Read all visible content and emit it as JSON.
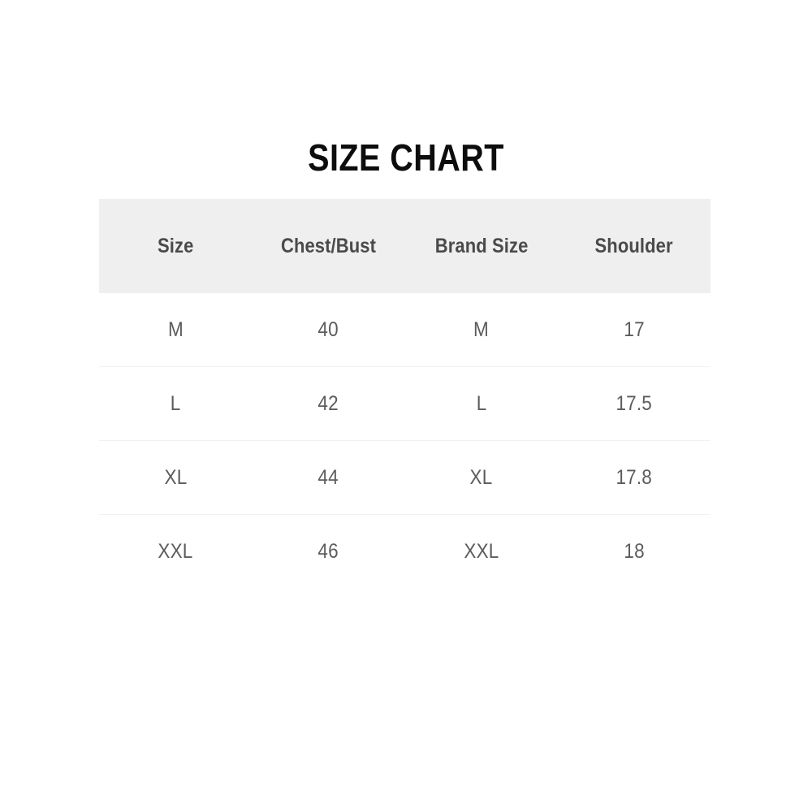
{
  "title": "SIZE CHART",
  "table": {
    "columns": [
      "Size",
      "Chest/Bust",
      "Brand Size",
      "Shoulder"
    ],
    "rows": [
      {
        "size": "M",
        "chest_bust": "40",
        "brand_size": "M",
        "shoulder": "17"
      },
      {
        "size": "L",
        "chest_bust": "42",
        "brand_size": "L",
        "shoulder": "17.5"
      },
      {
        "size": "XL",
        "chest_bust": "44",
        "brand_size": "XL",
        "shoulder": "17.8"
      },
      {
        "size": "XXL",
        "chest_bust": "46",
        "brand_size": "XXL",
        "shoulder": "18"
      }
    ]
  },
  "colors": {
    "background": "#ffffff",
    "header_band": "#efefef",
    "header_text": "#4a4a4a",
    "cell_text": "#5c5c5c",
    "title_text": "#0d0d0d",
    "row_divider": "#f2f2f2"
  },
  "chart_data": {
    "type": "table",
    "title": "SIZE CHART",
    "columns": [
      "Size",
      "Chest/Bust",
      "Brand Size",
      "Shoulder"
    ],
    "rows": [
      [
        "M",
        "40",
        "M",
        "17"
      ],
      [
        "L",
        "42",
        "L",
        "17.5"
      ],
      [
        "XL",
        "44",
        "XL",
        "17.8"
      ],
      [
        "XXL",
        "46",
        "XXL",
        "18"
      ]
    ]
  }
}
